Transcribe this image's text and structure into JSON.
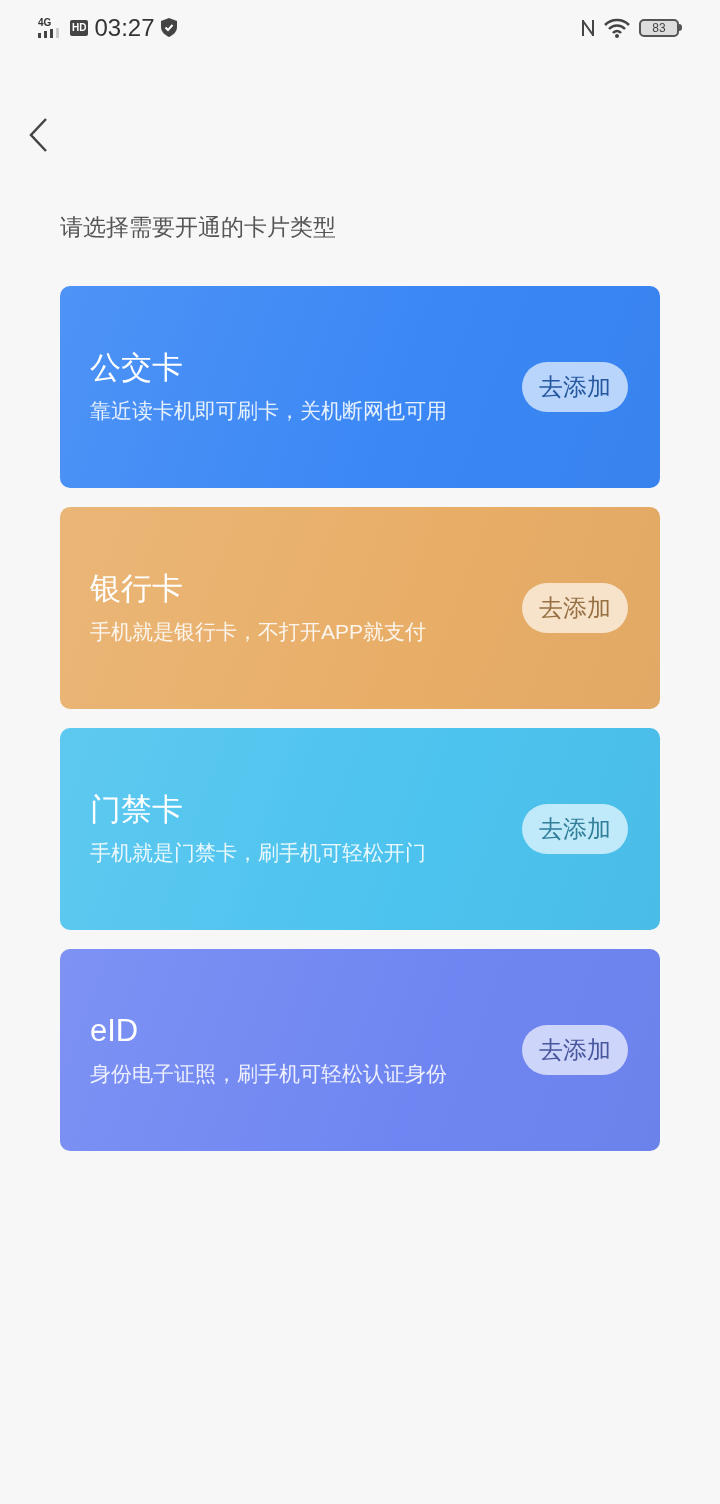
{
  "status_bar": {
    "network": "4G",
    "hd": "HD",
    "time": "03:27",
    "battery": "83"
  },
  "prompt": "请选择需要开通的卡片类型",
  "cards": [
    {
      "title": "公交卡",
      "subtitle": "靠近读卡机即可刷卡，关机断网也可用",
      "button": "去添加",
      "color": "#3a87f5"
    },
    {
      "title": "银行卡",
      "subtitle": "手机就是银行卡，不打开APP就支付",
      "button": "去添加",
      "color": "#e8ae68"
    },
    {
      "title": "门禁卡",
      "subtitle": "手机就是门禁卡，刷手机可轻松开门",
      "button": "去添加",
      "color": "#4cc3ee"
    },
    {
      "title": "eID",
      "subtitle": "身份电子证照，刷手机可轻松认证身份",
      "button": "去添加",
      "color": "#6f86f2"
    }
  ]
}
